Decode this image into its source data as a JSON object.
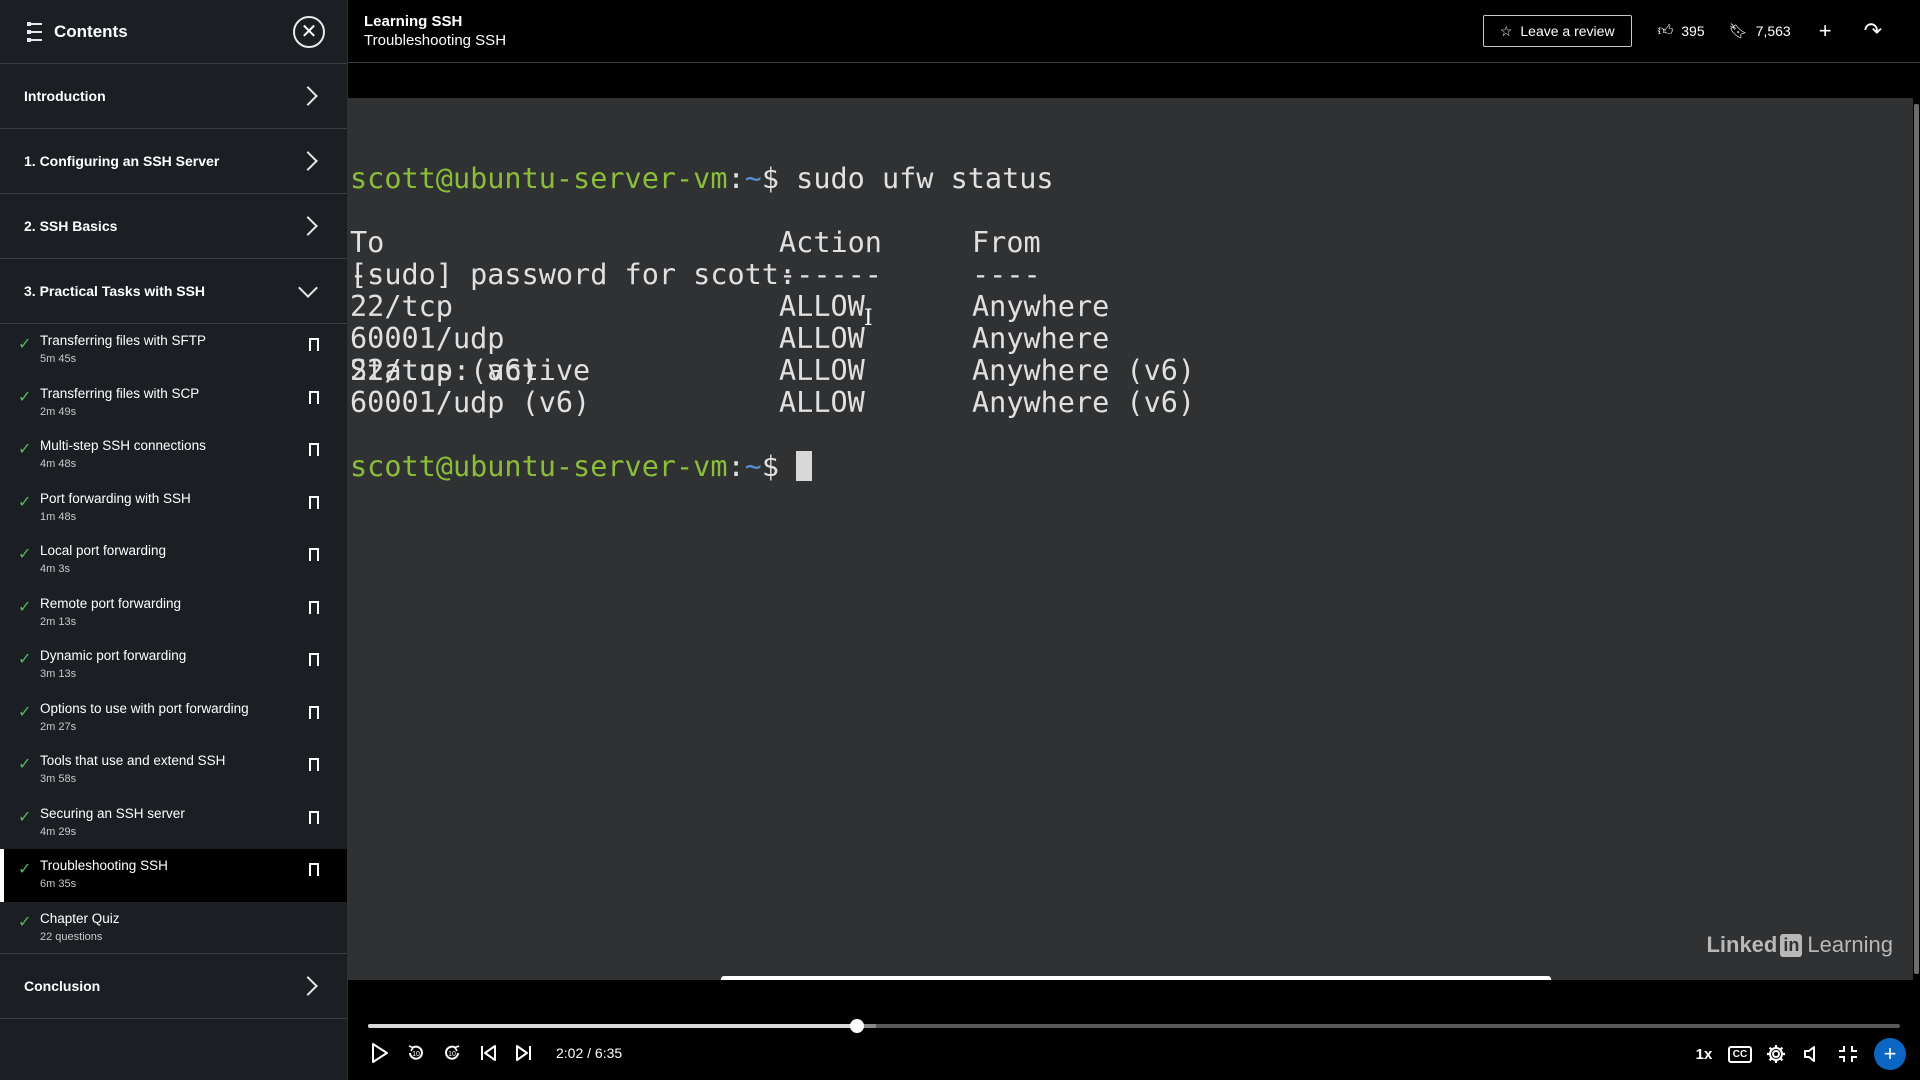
{
  "sidebar": {
    "title": "Contents",
    "sections_top": [
      {
        "label": "Introduction"
      },
      {
        "label": "1. Configuring an SSH Server"
      },
      {
        "label": "2. SSH Basics"
      },
      {
        "label": "3. Practical Tasks with SSH"
      }
    ],
    "items": [
      {
        "title": "Transferring files with SFTP",
        "duration": "5m 45s"
      },
      {
        "title": "Transferring files with SCP",
        "duration": "2m 49s"
      },
      {
        "title": "Multi-step SSH connections",
        "duration": "4m 48s"
      },
      {
        "title": "Port forwarding with SSH",
        "duration": "1m 48s"
      },
      {
        "title": "Local port forwarding",
        "duration": "4m 3s"
      },
      {
        "title": "Remote port forwarding",
        "duration": "2m 13s"
      },
      {
        "title": "Dynamic port forwarding",
        "duration": "3m 13s"
      },
      {
        "title": "Options to use with port forwarding",
        "duration": "2m 27s"
      },
      {
        "title": "Tools that use and extend SSH",
        "duration": "3m 58s"
      },
      {
        "title": "Securing an SSH server",
        "duration": "4m 29s"
      },
      {
        "title": "Troubleshooting SSH",
        "duration": "6m 35s"
      },
      {
        "title": "Chapter Quiz",
        "duration": "22 questions"
      }
    ],
    "section_bottom": "Conclusion"
  },
  "topbar": {
    "course": "Learning SSH",
    "video": "Troubleshooting SSH",
    "review_label": "Leave a review",
    "likes": "395",
    "saves": "7,563"
  },
  "terminal": {
    "prompt_user": "scott@ubuntu-server-vm",
    "prompt_sep": ":",
    "prompt_path": "~",
    "prompt_sym": "$",
    "command": " sudo ufw status",
    "line2": "[sudo] password for scott:",
    "line3": "Status: active",
    "headers": [
      "To",
      "Action",
      "From"
    ],
    "dashes": [
      "--",
      "------",
      "----"
    ],
    "rows": [
      [
        "22/tcp",
        "ALLOW",
        "Anywhere"
      ],
      [
        "60001/udp",
        "ALLOW",
        "Anywhere"
      ],
      [
        "22/tcp (v6)",
        "ALLOW",
        "Anywhere (v6)"
      ],
      [
        "60001/udp (v6)",
        "ALLOW",
        "Anywhere (v6)"
      ]
    ]
  },
  "watermark": {
    "part1": "Linked",
    "part2": "in",
    "part3": "Learning"
  },
  "player": {
    "time": "2:02 / 6:35",
    "progress_fraction": 0.3189,
    "speed": "1x",
    "cc": "CC",
    "skip_back": "10",
    "skip_fwd": "10"
  }
}
